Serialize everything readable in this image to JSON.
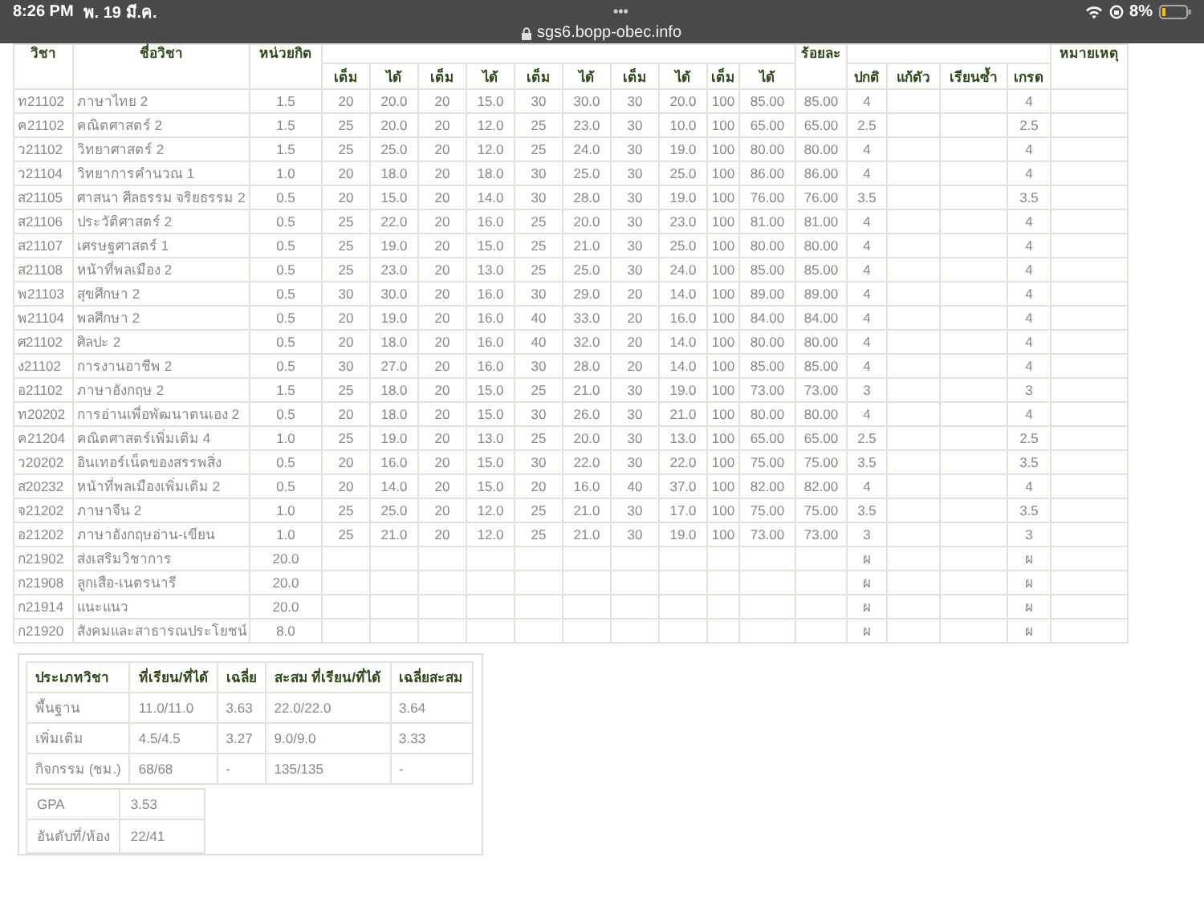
{
  "status_bar": {
    "time": "8:26 PM",
    "date": "พ. 19 มี.ค.",
    "dots": "•••",
    "url": "sgs6.bopp-obec.info",
    "battery": "8%"
  },
  "grades_table": {
    "columns": [
      "วิชา",
      "ชื่อวิชา",
      "หน่วยกิต",
      "ร้อยละ",
      "หมายเหตุ"
    ],
    "score_headers": [
      "เต็ม",
      "ได้",
      "เต็ม",
      "ได้",
      "เต็ม",
      "ได้",
      "เต็ม",
      "ได้",
      "เต็ม",
      "ได้"
    ],
    "grade_headers": [
      "ปกติ",
      "แก้ตัว",
      "เรียนซ้ำ",
      "เกรด"
    ],
    "rows": [
      {
        "code": "ท21102",
        "name": "ภาษาไทย 2",
        "credits": "1.5",
        "scores": [
          "20",
          "20.0",
          "20",
          "15.0",
          "30",
          "30.0",
          "30",
          "20.0",
          "100",
          "85.00"
        ],
        "percent": "85.00",
        "normal": "4",
        "grade": "4"
      },
      {
        "code": "ค21102",
        "name": "คณิตศาสตร์ 2",
        "credits": "1.5",
        "scores": [
          "25",
          "20.0",
          "20",
          "12.0",
          "25",
          "23.0",
          "30",
          "10.0",
          "100",
          "65.00"
        ],
        "percent": "65.00",
        "normal": "2.5",
        "grade": "2.5"
      },
      {
        "code": "ว21102",
        "name": "วิทยาศาสตร์ 2",
        "credits": "1.5",
        "scores": [
          "25",
          "25.0",
          "20",
          "12.0",
          "25",
          "24.0",
          "30",
          "19.0",
          "100",
          "80.00"
        ],
        "percent": "80.00",
        "normal": "4",
        "grade": "4"
      },
      {
        "code": "ว21104",
        "name": "วิทยาการคำนวณ 1",
        "credits": "1.0",
        "scores": [
          "20",
          "18.0",
          "20",
          "18.0",
          "30",
          "25.0",
          "30",
          "25.0",
          "100",
          "86.00"
        ],
        "percent": "86.00",
        "normal": "4",
        "grade": "4"
      },
      {
        "code": "ส21105",
        "name": "ศาสนา ศีลธรรม จริยธรรม 2",
        "credits": "0.5",
        "scores": [
          "20",
          "15.0",
          "20",
          "14.0",
          "30",
          "28.0",
          "30",
          "19.0",
          "100",
          "76.00"
        ],
        "percent": "76.00",
        "normal": "3.5",
        "grade": "3.5"
      },
      {
        "code": "ส21106",
        "name": "ประวัติศาสตร์ 2",
        "credits": "0.5",
        "scores": [
          "25",
          "22.0",
          "20",
          "16.0",
          "25",
          "20.0",
          "30",
          "23.0",
          "100",
          "81.00"
        ],
        "percent": "81.00",
        "normal": "4",
        "grade": "4"
      },
      {
        "code": "ส21107",
        "name": "เศรษฐศาสตร์ 1",
        "credits": "0.5",
        "scores": [
          "25",
          "19.0",
          "20",
          "15.0",
          "25",
          "21.0",
          "30",
          "25.0",
          "100",
          "80.00"
        ],
        "percent": "80.00",
        "normal": "4",
        "grade": "4"
      },
      {
        "code": "ส21108",
        "name": "หน้าที่พลเมือง 2",
        "credits": "0.5",
        "scores": [
          "25",
          "23.0",
          "20",
          "13.0",
          "25",
          "25.0",
          "30",
          "24.0",
          "100",
          "85.00"
        ],
        "percent": "85.00",
        "normal": "4",
        "grade": "4"
      },
      {
        "code": "พ21103",
        "name": "สุขศึกษา 2",
        "credits": "0.5",
        "scores": [
          "30",
          "30.0",
          "20",
          "16.0",
          "30",
          "29.0",
          "20",
          "14.0",
          "100",
          "89.00"
        ],
        "percent": "89.00",
        "normal": "4",
        "grade": "4"
      },
      {
        "code": "พ21104",
        "name": "พลศึกษา 2",
        "credits": "0.5",
        "scores": [
          "20",
          "19.0",
          "20",
          "16.0",
          "40",
          "33.0",
          "20",
          "16.0",
          "100",
          "84.00"
        ],
        "percent": "84.00",
        "normal": "4",
        "grade": "4"
      },
      {
        "code": "ศ21102",
        "name": "ศิลปะ 2",
        "credits": "0.5",
        "scores": [
          "20",
          "18.0",
          "20",
          "16.0",
          "40",
          "32.0",
          "20",
          "14.0",
          "100",
          "80.00"
        ],
        "percent": "80.00",
        "normal": "4",
        "grade": "4"
      },
      {
        "code": "ง21102",
        "name": "การงานอาชีพ 2",
        "credits": "0.5",
        "scores": [
          "30",
          "27.0",
          "20",
          "16.0",
          "30",
          "28.0",
          "20",
          "14.0",
          "100",
          "85.00"
        ],
        "percent": "85.00",
        "normal": "4",
        "grade": "4"
      },
      {
        "code": "อ21102",
        "name": "ภาษาอังกฤษ 2",
        "credits": "1.5",
        "scores": [
          "25",
          "18.0",
          "20",
          "15.0",
          "25",
          "21.0",
          "30",
          "19.0",
          "100",
          "73.00"
        ],
        "percent": "73.00",
        "normal": "3",
        "grade": "3"
      },
      {
        "code": "ท20202",
        "name": "การอ่านเพื่อพัฒนาตนเอง 2",
        "credits": "0.5",
        "scores": [
          "20",
          "18.0",
          "20",
          "15.0",
          "30",
          "26.0",
          "30",
          "21.0",
          "100",
          "80.00"
        ],
        "percent": "80.00",
        "normal": "4",
        "grade": "4"
      },
      {
        "code": "ค21204",
        "name": "คณิตศาสตร์เพิ่มเติม 4",
        "credits": "1.0",
        "scores": [
          "25",
          "19.0",
          "20",
          "13.0",
          "25",
          "20.0",
          "30",
          "13.0",
          "100",
          "65.00"
        ],
        "percent": "65.00",
        "normal": "2.5",
        "grade": "2.5"
      },
      {
        "code": "ว20202",
        "name": "อินเทอร์เน็ตของสรรพสิ่ง",
        "credits": "0.5",
        "scores": [
          "20",
          "16.0",
          "20",
          "15.0",
          "30",
          "22.0",
          "30",
          "22.0",
          "100",
          "75.00"
        ],
        "percent": "75.00",
        "normal": "3.5",
        "grade": "3.5"
      },
      {
        "code": "ส20232",
        "name": "หน้าที่พลเมืองเพิ่มเติม 2",
        "credits": "0.5",
        "scores": [
          "20",
          "14.0",
          "20",
          "15.0",
          "20",
          "16.0",
          "40",
          "37.0",
          "100",
          "82.00"
        ],
        "percent": "82.00",
        "normal": "4",
        "grade": "4"
      },
      {
        "code": "จ21202",
        "name": "ภาษาจีน 2",
        "credits": "1.0",
        "scores": [
          "25",
          "25.0",
          "20",
          "12.0",
          "25",
          "21.0",
          "30",
          "17.0",
          "100",
          "75.00"
        ],
        "percent": "75.00",
        "normal": "3.5",
        "grade": "3.5"
      },
      {
        "code": "อ21202",
        "name": "ภาษาอังกฤษอ่าน-เขียน",
        "credits": "1.0",
        "scores": [
          "25",
          "21.0",
          "20",
          "12.0",
          "25",
          "21.0",
          "30",
          "19.0",
          "100",
          "73.00"
        ],
        "percent": "73.00",
        "normal": "3",
        "grade": "3"
      },
      {
        "code": "ก21902",
        "name": "ส่งเสริมวิชาการ",
        "credits": "20.0",
        "normal": "ผ",
        "grade": "ผ"
      },
      {
        "code": "ก21908",
        "name": "ลูกเสือ-เนตรนารี",
        "credits": "20.0",
        "normal": "ผ",
        "grade": "ผ"
      },
      {
        "code": "ก21914",
        "name": "แนะแนว",
        "credits": "20.0",
        "normal": "ผ",
        "grade": "ผ"
      },
      {
        "code": "ก21920",
        "name": "สังคมและสาธารณประโยชน์",
        "credits": "8.0",
        "normal": "ผ",
        "grade": "ผ"
      }
    ]
  },
  "summary": {
    "columns": [
      "ประเภทวิชา",
      "ที่เรียน/ที่ได้",
      "เฉลี่ย",
      "สะสม ที่เรียน/ที่ได้",
      "เฉลี่ยสะสม"
    ],
    "rows": [
      [
        "พื้นฐาน",
        "11.0/11.0",
        "3.63",
        "22.0/22.0",
        "3.64"
      ],
      [
        "เพิ่มเติม",
        "4.5/4.5",
        "3.27",
        "9.0/9.0",
        "3.33"
      ],
      [
        "กิจกรรม (ชม.)",
        "68/68",
        "-",
        "135/135",
        "-"
      ]
    ]
  },
  "gpa": [
    {
      "label": "GPA",
      "value": "3.53"
    },
    {
      "label": "อันดับที่/ห้อง",
      "value": "22/41"
    }
  ]
}
